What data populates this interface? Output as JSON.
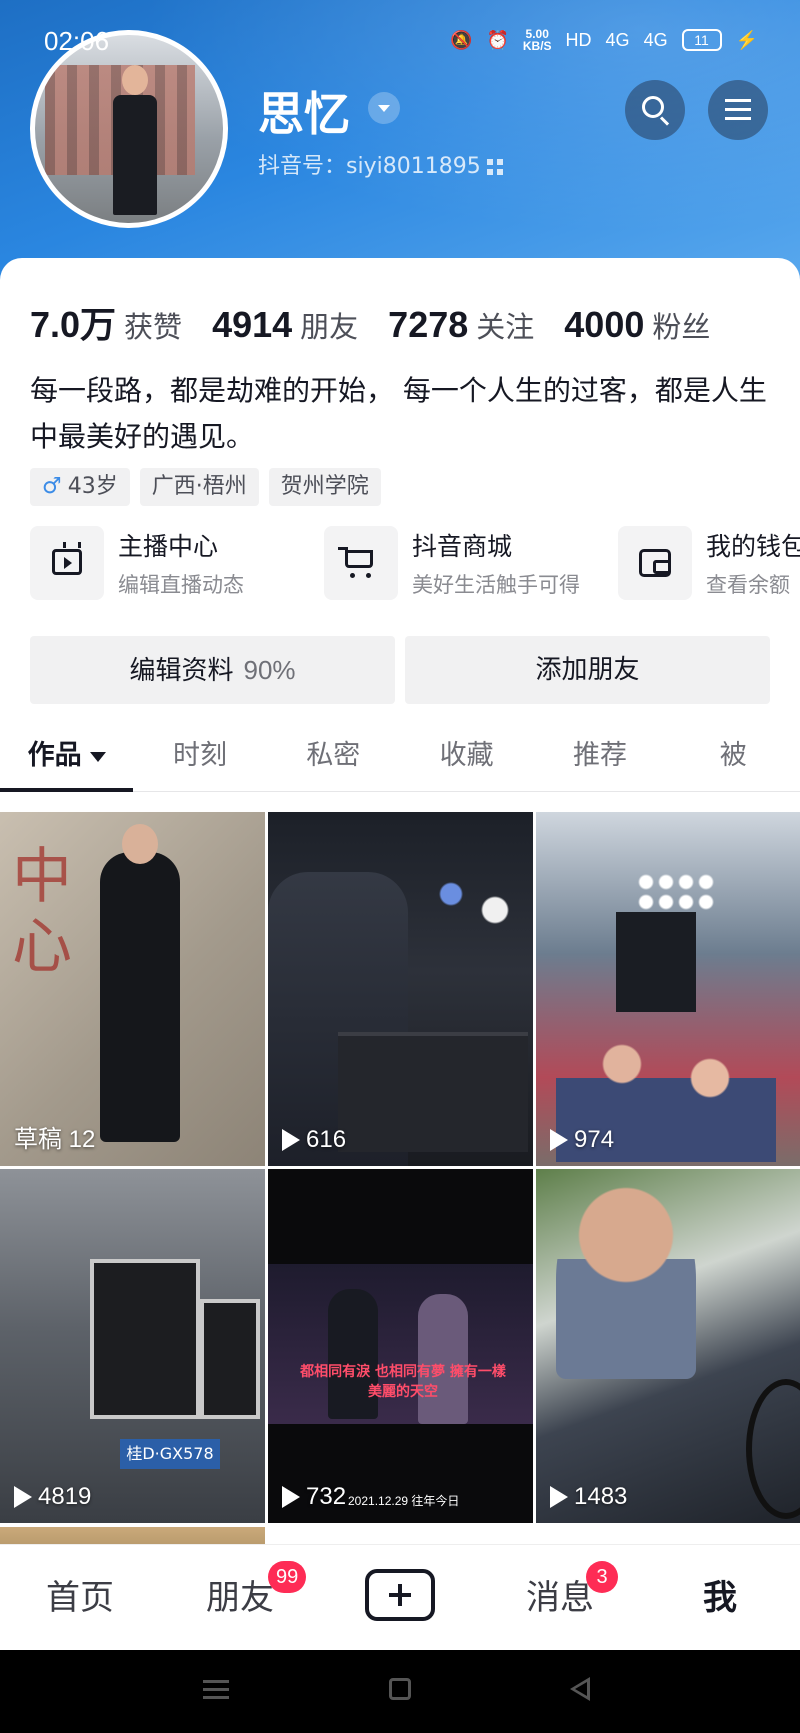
{
  "status_bar": {
    "time": "02:06",
    "net_speed": "5.00",
    "net_unit": "KB/S",
    "hd": "HD",
    "signal1": "4G",
    "signal2": "4G",
    "battery": "11"
  },
  "profile": {
    "nickname": "思忆",
    "douyin_id": "抖音号：siyi8011895"
  },
  "stats": [
    {
      "num": "7.0万",
      "label": "获赞"
    },
    {
      "num": "4914",
      "label": "朋友"
    },
    {
      "num": "7278",
      "label": "关注"
    },
    {
      "num": "4000",
      "label": "粉丝"
    }
  ],
  "bio": "每一段路，都是劫难的开始， 每一个人生的过客，都是人生中最美好的遇见。",
  "tags": {
    "gender_icon": "♂",
    "age": "43岁",
    "location": "广西·梧州",
    "school": "贺州学院"
  },
  "services": [
    {
      "title": "主播中心",
      "sub": "编辑直播动态",
      "icon": "tv-icon"
    },
    {
      "title": "抖音商城",
      "sub": "美好生活触手可得",
      "icon": "cart-icon"
    },
    {
      "title": "我的钱包",
      "sub": "查看余额",
      "icon": "wallet-icon"
    }
  ],
  "actions": {
    "edit": "编辑资料",
    "edit_pct": "90%",
    "add_friend": "添加朋友"
  },
  "tabs": [
    "作品",
    "时刻",
    "私密",
    "收藏",
    "推荐",
    "被"
  ],
  "videos": [
    {
      "label": "草稿 12",
      "type": "draft"
    },
    {
      "label": "616",
      "type": "play"
    },
    {
      "label": "974",
      "type": "play"
    },
    {
      "label": "4819",
      "type": "play"
    },
    {
      "label": "732",
      "type": "play"
    },
    {
      "label": "1483",
      "type": "play"
    }
  ],
  "video_extra": {
    "date_tag": "2021.12.29 往年今日",
    "lyric": "都相同有淚 也相同有夢 擁有一樣美麗的天空",
    "plate": "桂D·GX578",
    "script_text": "中心"
  },
  "bottom_nav": {
    "home": "首页",
    "friends": "朋友",
    "friends_badge": "99",
    "messages": "消息",
    "messages_badge": "3",
    "me": "我"
  }
}
